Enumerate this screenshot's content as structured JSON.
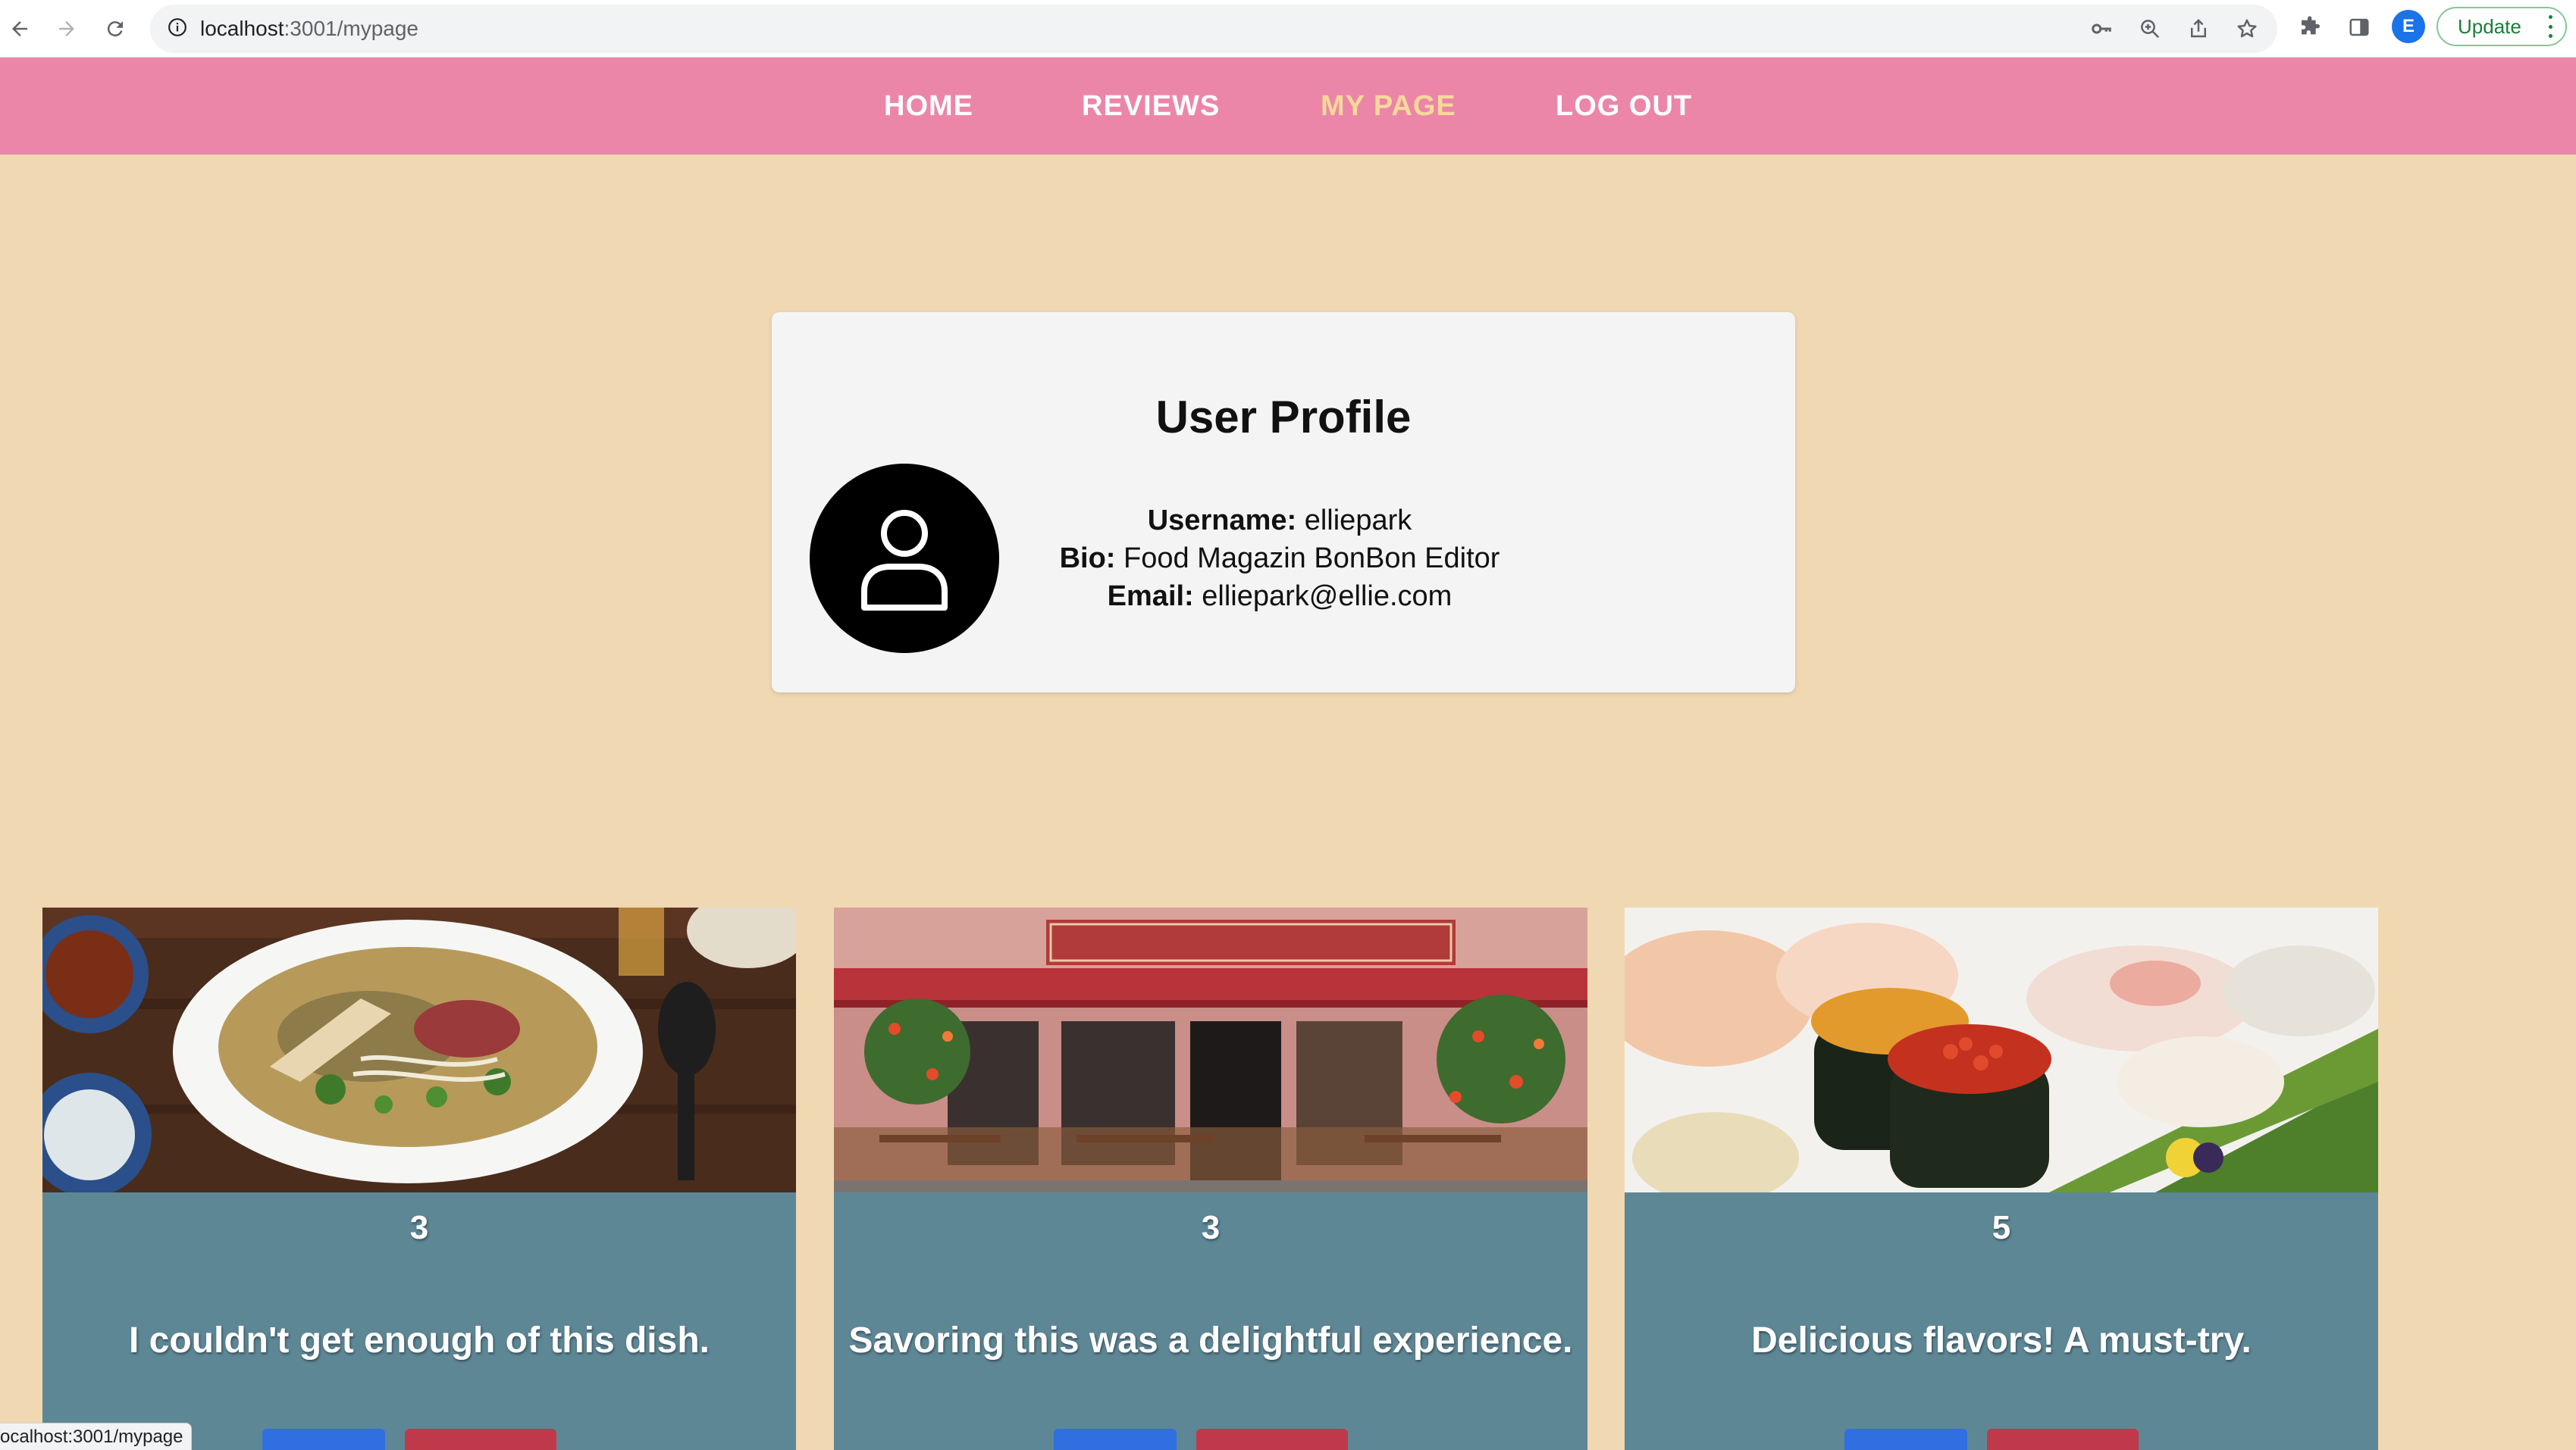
{
  "browser": {
    "url_host": "localhost",
    "url_path": ":3001/mypage",
    "profile_initial": "E",
    "update_label": "Update"
  },
  "nav": {
    "items": [
      {
        "label": "HOME",
        "active": false
      },
      {
        "label": "REVIEWS",
        "active": false
      },
      {
        "label": "MY PAGE",
        "active": true
      },
      {
        "label": "LOG OUT",
        "active": false
      }
    ]
  },
  "profile": {
    "title": "User Profile",
    "username_label": "Username:",
    "username": "elliepark",
    "bio_label": "Bio:",
    "bio": "Food Magazin BonBon Editor",
    "email_label": "Email:",
    "email": "elliepark@ellie.com"
  },
  "reviews": [
    {
      "rating": "3",
      "text": "I couldn't get enough of this dish.",
      "image": "pho-bowl"
    },
    {
      "rating": "3",
      "text": "Savoring this was a delightful experience.",
      "image": "morini-restaurant-front"
    },
    {
      "rating": "5",
      "text": "Delicious flavors! A must-try.",
      "image": "sushi-plate"
    }
  ],
  "status_bar": {
    "text": "ocalhost:3001/mypage"
  },
  "colors": {
    "page_background": "#efd8b2",
    "navbar": "#ec86a9",
    "nav_active": "#f6d99a",
    "card_background": "#f4f4f4",
    "review_card": "#5e8796",
    "edit_button": "#2f6fe0",
    "delete_button": "#c0394b"
  }
}
